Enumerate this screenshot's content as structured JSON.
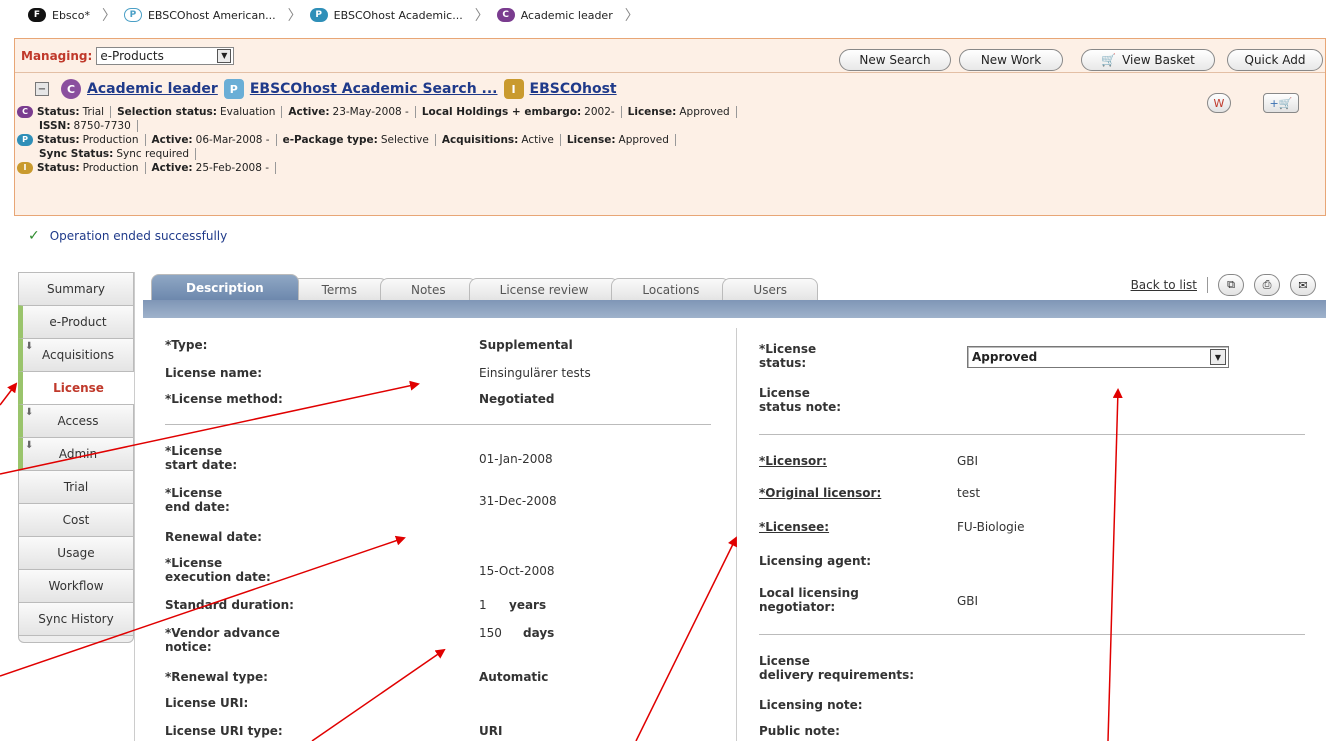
{
  "breadcrumbs": [
    {
      "badge": "F",
      "badge_color": "#111111",
      "label": "Ebsco*"
    },
    {
      "badge": "P",
      "badge_color": "#4a9fc6",
      "label": "EBSCOhost American..."
    },
    {
      "badge": "P",
      "badge_color": "#2f8fb8",
      "label": "EBSCOhost Academic..."
    },
    {
      "badge": "C",
      "badge_color": "#7a3c8f",
      "label": "Academic leader"
    }
  ],
  "managing": {
    "label": "Managing:",
    "value": "e-Products"
  },
  "toolbar": {
    "new_search": "New Search",
    "new_work": "New Work",
    "view_basket": "View Basket",
    "quick_add": "Quick Add"
  },
  "header": {
    "title_c": "Academic leader",
    "title_p": "EBSCOhost Academic Search ...",
    "title_i": "EBSCOhost",
    "status_c": {
      "status_label": "Status:",
      "status": "Trial",
      "selection_label": "Selection status:",
      "selection": "Evaluation",
      "active_label": "Active:",
      "active": "23-May-2008 -",
      "holdings_label": "Local Holdings + embargo:",
      "holdings": "2002-",
      "license_label": "License:",
      "license": "Approved",
      "issn_label": "ISSN:",
      "issn": "8750-7730"
    },
    "status_p": {
      "status_label": "Status:",
      "status": "Production",
      "active_label": "Active:",
      "active": "06-Mar-2008 -",
      "pkg_label": "e-Package type:",
      "pkg": "Selective",
      "acq_label": "Acquisitions:",
      "acq": "Active",
      "license_label": "License:",
      "license": "Approved",
      "sync_label": "Sync Status:",
      "sync": "Sync required"
    },
    "status_i": {
      "status_label": "Status:",
      "status": "Production",
      "active_label": "Active:",
      "active": "25-Feb-2008 -"
    }
  },
  "message": "Operation ended successfully",
  "sidebar": {
    "items": [
      "Summary",
      "e-Product",
      "Acquisitions",
      "License",
      "Access",
      "Admin",
      "Trial",
      "Cost",
      "Usage",
      "Workflow",
      "Sync History"
    ]
  },
  "tabs": [
    "Description",
    "Terms",
    "Notes",
    "License review",
    "Locations",
    "Users"
  ],
  "back_to_list": "Back to list",
  "left_fields": {
    "type_l": "*Type:",
    "type_v": "Supplemental",
    "name_l": "License name:",
    "name_v": "Einsingulärer tests",
    "method_l": "*License method:",
    "method_v": "Negotiated",
    "start_l1": "*License",
    "start_l2": "start date:",
    "start_v": "01-Jan-2008",
    "end_l1": "*License",
    "end_l2": "end date:",
    "end_v": "31-Dec-2008",
    "renewal_l": "Renewal date:",
    "exec_l1": "*License",
    "exec_l2": "execution date:",
    "exec_v": "15-Oct-2008",
    "dur_l": "Standard duration:",
    "dur_n": "1",
    "dur_u": "years",
    "notice_l1": "*Vendor advance",
    "notice_l2": "notice:",
    "notice_n": "150",
    "notice_u": "days",
    "rtype_l": "*Renewal type:",
    "rtype_v": "Automatic",
    "uri_l": "License URI:",
    "uritype_l": "License URI type:",
    "uritype_v": "URI"
  },
  "right_fields": {
    "status_l1": "*License",
    "status_l2": "status:",
    "status_v": "Approved",
    "snote_l1": "License",
    "snote_l2": "status note:",
    "licensor_l": "*Licensor:",
    "licensor_v": "GBI",
    "orig_l": "*Original licensor:",
    "orig_v": "test",
    "licensee_l": "*Licensee:",
    "licensee_v": "FU-Biologie",
    "agent_l": "Licensing agent:",
    "neg_l1": "Local licensing",
    "neg_l2": "negotiator:",
    "neg_v": "GBI",
    "deliv_l1": "License",
    "deliv_l2": "delivery requirements:",
    "lnote_l": "Licensing note:",
    "pnote_l": "Public note:"
  },
  "colors": {
    "accent_red": "#c0392b",
    "link_blue": "#1f3a8a",
    "tab_blue": "#7f96b6",
    "header_bg": "#fdf0e6",
    "annotation_red": "#e00000"
  }
}
